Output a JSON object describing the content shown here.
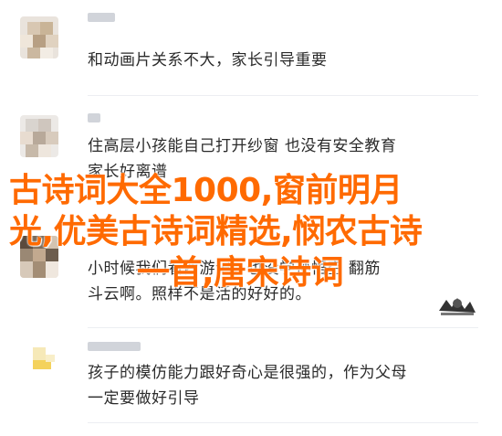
{
  "comments": [
    {
      "lines": [
        "和动画片关系不大，家长引导重要"
      ]
    },
    {
      "lines": [
        "住高层小孩能自己打开纱窗 也没有安全教育",
        "家长好离谱"
      ]
    },
    {
      "lines": [
        "小时候我们看西游记，也没学孙悟空 翻筋",
        "斗云啊。照样不是活的好好的。"
      ]
    },
    {
      "lines": [
        "孩子的模仿能力跟好奇心是很强的，作为父母",
        "一定要做好引导"
      ]
    }
  ],
  "overlay": {
    "line1": "古诗词大全1000,窗前明月",
    "line2": "光,优美古诗词精选,悯农古诗",
    "line3": "一首,唐宋诗词"
  },
  "colors": {
    "overlay_text": "#ff6a00",
    "body_text": "#2a2a2a",
    "name_blur": "#c9ccd3"
  },
  "icons": {
    "sticker": "cartoon-sticker-icon"
  }
}
